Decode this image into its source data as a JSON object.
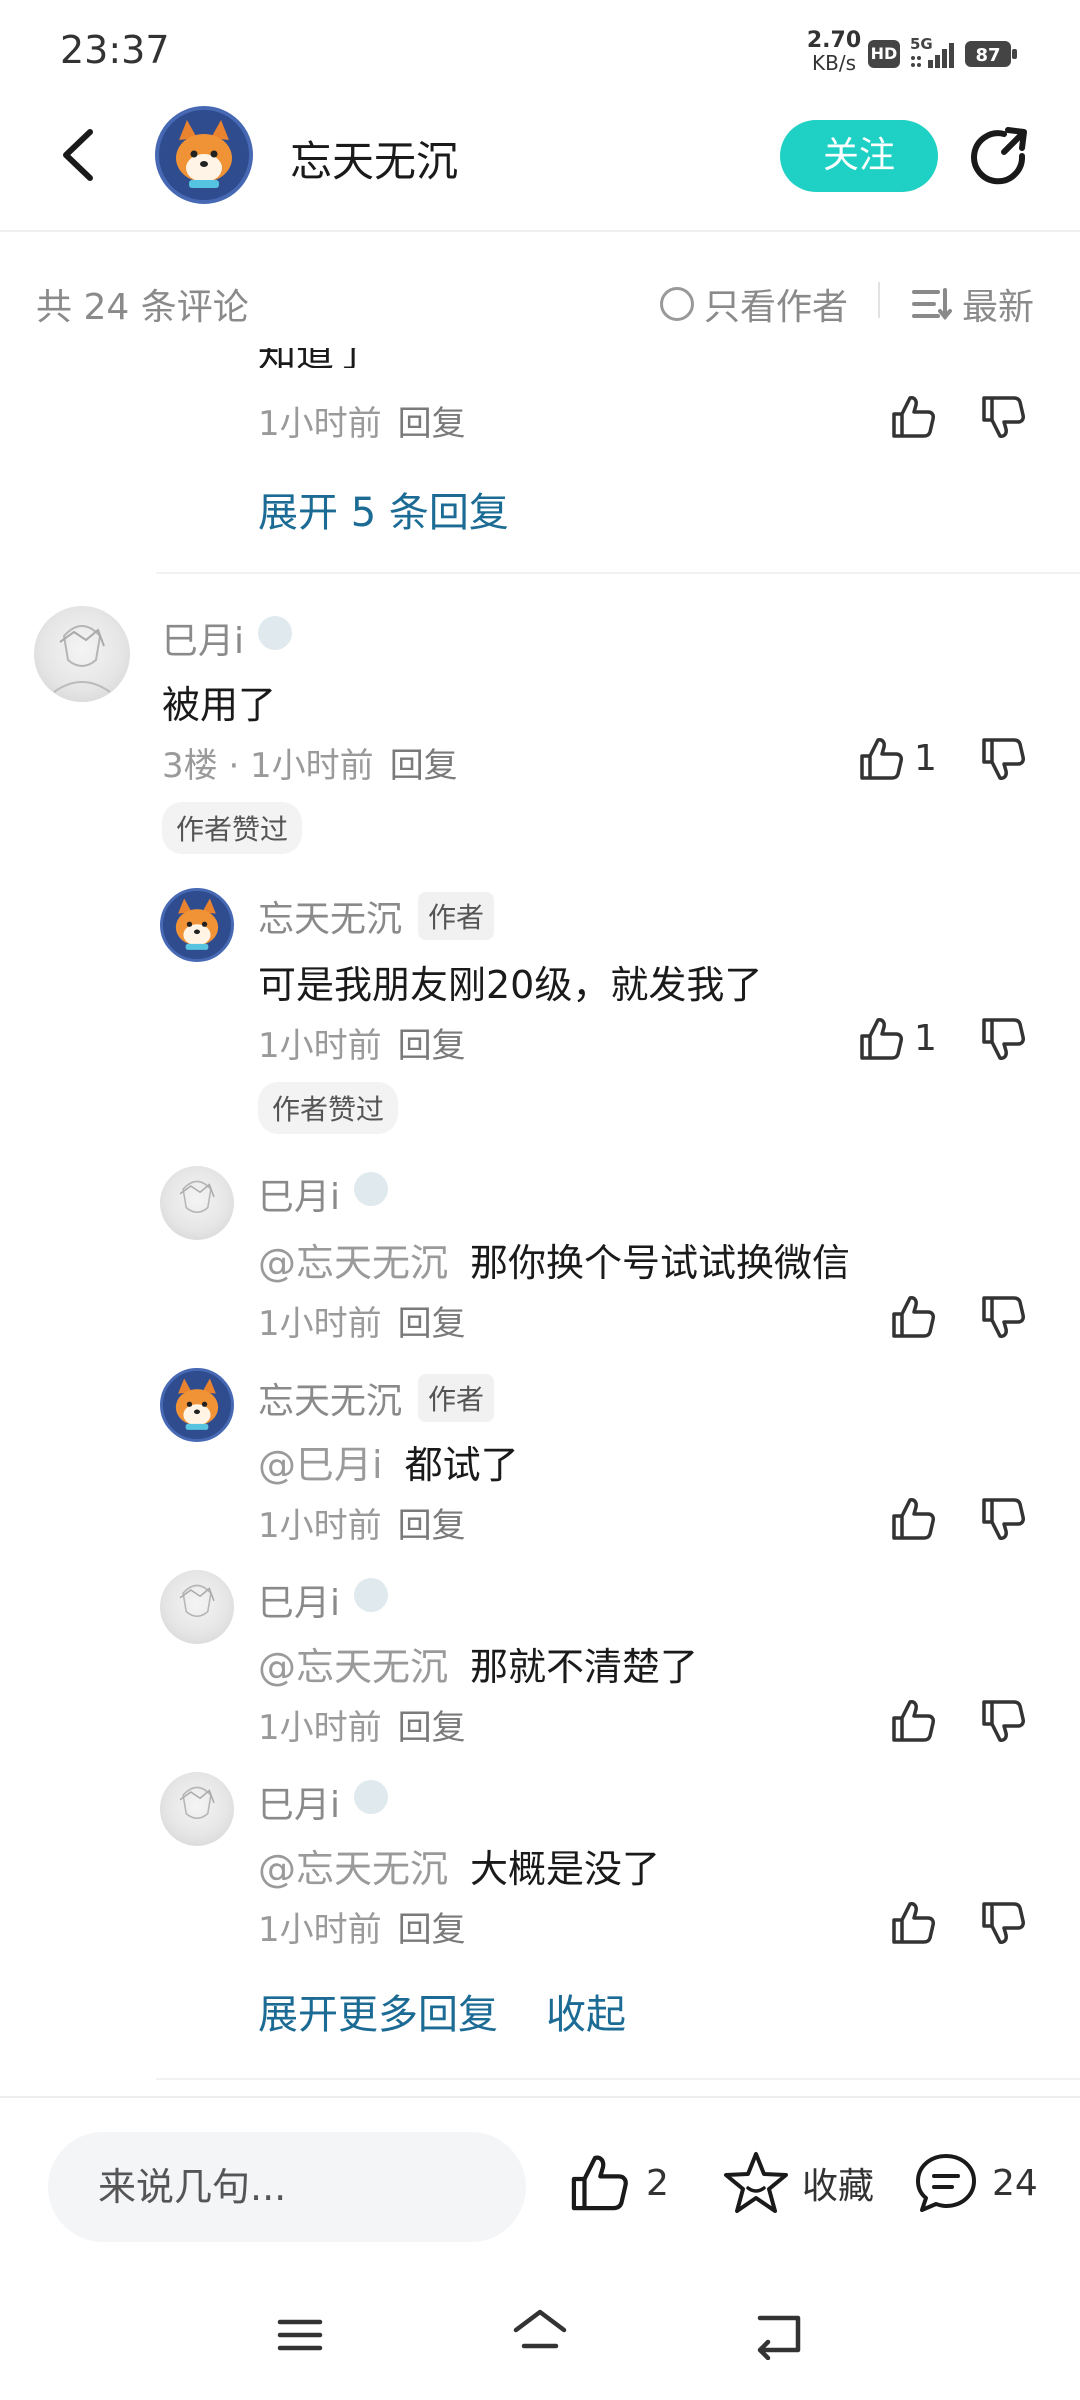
{
  "status_bar": {
    "time": "23:37",
    "net_speed_value": "2.70",
    "net_speed_unit": "KB/s",
    "hd": "HD",
    "network": "5G",
    "battery": "87"
  },
  "header": {
    "name": "忘天无沉",
    "follow_label": "关注"
  },
  "comments_bar": {
    "count_label": "共 24 条评论",
    "only_author_label": "只看作者",
    "sort_label": "最新"
  },
  "partial_top": {
    "time": "1小时前",
    "reply": "回复",
    "expand_label": "展开 5 条回复"
  },
  "main_comment": {
    "user": "巳月i",
    "text": "被用了",
    "meta": "3楼 · 1小时前",
    "reply": "回复",
    "likes": "1",
    "badge": "作者赞过"
  },
  "replies": [
    {
      "user": "忘天无沉",
      "tag": "作者",
      "mention": "",
      "text": "可是我朋友刚20级，就发我了",
      "time": "1小时前",
      "reply": "回复",
      "likes": "1",
      "badge": "作者赞过"
    },
    {
      "user": "巳月i",
      "tag": "",
      "mention": "@忘天无沉",
      "text": "那你换个号试试换微信",
      "time": "1小时前",
      "reply": "回复",
      "likes": "",
      "badge": ""
    },
    {
      "user": "忘天无沉",
      "tag": "作者",
      "mention": "@巳月i",
      "text": "都试了",
      "time": "1小时前",
      "reply": "回复",
      "likes": "",
      "badge": ""
    },
    {
      "user": "巳月i",
      "tag": "",
      "mention": "@忘天无沉",
      "text": "那就不清楚了",
      "time": "1小时前",
      "reply": "回复",
      "likes": "",
      "badge": ""
    },
    {
      "user": "巳月i",
      "tag": "",
      "mention": "@忘天无沉",
      "text": "大概是没了",
      "time": "1小时前",
      "reply": "回复",
      "likes": "",
      "badge": ""
    }
  ],
  "expand_more": {
    "more_label": "展开更多回复",
    "collapse_label": "收起"
  },
  "bottom_bar": {
    "input_placeholder": "来说几句...",
    "like_count": "2",
    "favorite_label": "收藏",
    "comment_count": "24"
  }
}
